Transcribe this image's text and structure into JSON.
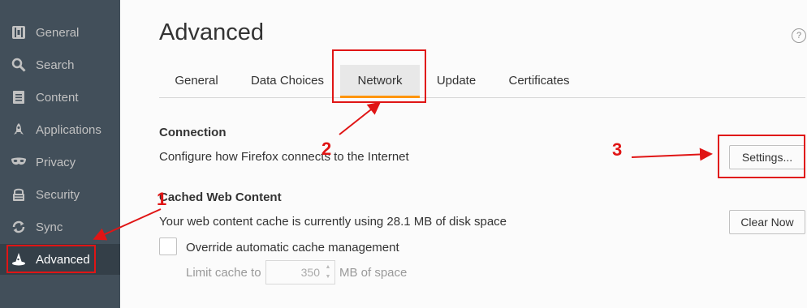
{
  "sidebar": {
    "items": [
      {
        "label": "General",
        "icon": "general-icon"
      },
      {
        "label": "Search",
        "icon": "search-icon"
      },
      {
        "label": "Content",
        "icon": "document-icon"
      },
      {
        "label": "Applications",
        "icon": "rocket-icon"
      },
      {
        "label": "Privacy",
        "icon": "mask-icon"
      },
      {
        "label": "Security",
        "icon": "security-icon"
      },
      {
        "label": "Sync",
        "icon": "sync-icon"
      },
      {
        "label": "Advanced",
        "icon": "wizard-hat-icon",
        "selected": true
      }
    ]
  },
  "header": {
    "title": "Advanced",
    "help": "?"
  },
  "tabs": [
    {
      "label": "General"
    },
    {
      "label": "Data Choices"
    },
    {
      "label": "Network",
      "selected": true
    },
    {
      "label": "Update"
    },
    {
      "label": "Certificates"
    }
  ],
  "connection": {
    "title": "Connection",
    "description": "Configure how Firefox connects to the Internet",
    "settings_button": "Settings..."
  },
  "cache": {
    "title": "Cached Web Content",
    "usage_text": "Your web content cache is currently using 28.1 MB of disk space",
    "clear_button": "Clear Now",
    "override_label": "Override automatic cache management",
    "override_checked": false,
    "limit_label": "Limit cache to",
    "limit_value": "350",
    "limit_suffix": "MB of space"
  },
  "annotations": {
    "one": "1",
    "two": "2",
    "three": "3"
  },
  "colors": {
    "accent": "#ff9500",
    "annotation": "#e01515",
    "sidebar_bg": "#424f5a"
  }
}
